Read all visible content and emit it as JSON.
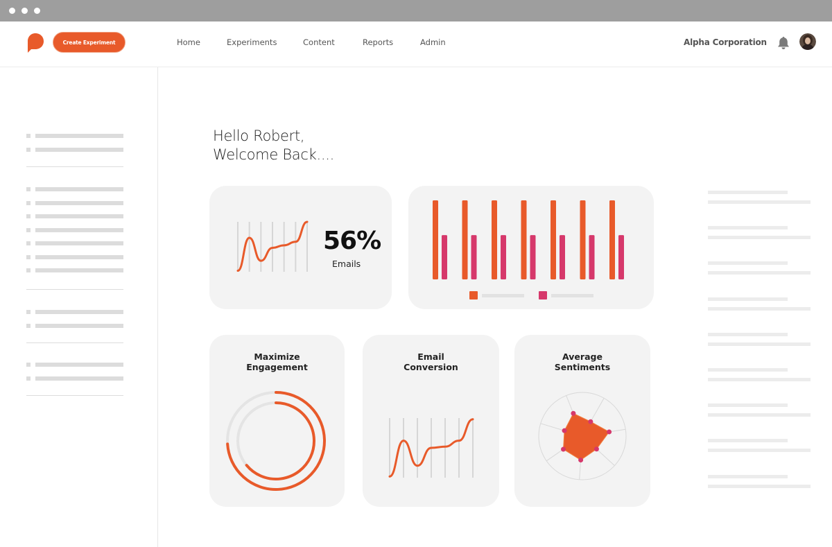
{
  "window": {
    "controls": [
      "close",
      "minimize",
      "maximize"
    ]
  },
  "header": {
    "logo_icon": "speech-bubble-logo-icon",
    "create_button": "Create Experiment",
    "nav": [
      {
        "label": "Home"
      },
      {
        "label": "Experiments"
      },
      {
        "label": "Content"
      },
      {
        "label": "Reports"
      },
      {
        "label": "Admin"
      }
    ],
    "organization": "Alpha Corporation",
    "notification_icon": "bell-icon",
    "avatar_icon": "user-avatar"
  },
  "colors": {
    "accent": "#e85a2a",
    "secondary": "#d6386b",
    "card_bg": "#f3f3f3",
    "placeholder": "#dcdcdc"
  },
  "greeting": {
    "line1": "Hello Robert,",
    "line2": "Welcome Back...."
  },
  "email_stat": {
    "value": "56%",
    "label": "Emails"
  },
  "cards": {
    "engagement": {
      "title_line1": "Maximize",
      "title_line2": "Engagement"
    },
    "conversion": {
      "title_line1": "Email",
      "title_line2": "Conversion"
    },
    "sentiments": {
      "title_line1": "Average",
      "title_line2": "Sentiments"
    }
  },
  "chart_data": [
    {
      "type": "line",
      "name": "emails-sparkline",
      "title": "",
      "x": [
        0,
        1,
        2,
        3,
        4,
        5,
        6
      ],
      "values": [
        0.02,
        0.68,
        0.22,
        0.48,
        0.53,
        0.6,
        1.0
      ],
      "grid": true,
      "ylim": [
        0,
        1
      ]
    },
    {
      "type": "bar",
      "name": "grouped-bars",
      "categories": [
        "1",
        "2",
        "3",
        "4",
        "5",
        "6",
        "7"
      ],
      "series": [
        {
          "name": "",
          "color": "#e85a2a",
          "values": [
            1,
            1,
            1,
            1,
            1,
            1,
            1
          ]
        },
        {
          "name": "",
          "color": "#d6386b",
          "values": [
            0.56,
            0.56,
            0.56,
            0.56,
            0.56,
            0.56,
            0.56
          ]
        }
      ],
      "ylim": [
        0,
        1
      ],
      "legend": "bottom"
    },
    {
      "type": "pie",
      "name": "engagement-rings",
      "title": "Maximize Engagement",
      "series": [
        {
          "name": "outer",
          "value": 0.74
        },
        {
          "name": "inner",
          "value": 0.64
        }
      ]
    },
    {
      "type": "line",
      "name": "conversion-line",
      "title": "Email Conversion",
      "x": [
        0,
        1,
        2,
        3,
        4,
        5,
        6
      ],
      "values": [
        0.02,
        0.62,
        0.2,
        0.5,
        0.52,
        0.62,
        0.98
      ],
      "grid": true,
      "ylim": [
        0,
        1
      ]
    },
    {
      "type": "scatter",
      "name": "sentiment-radar",
      "title": "Average Sentiments",
      "axes": 7,
      "values": [
        0.56,
        0.38,
        0.62,
        0.44,
        0.55,
        0.53,
        0.43
      ],
      "rlim": [
        0,
        1
      ]
    }
  ]
}
